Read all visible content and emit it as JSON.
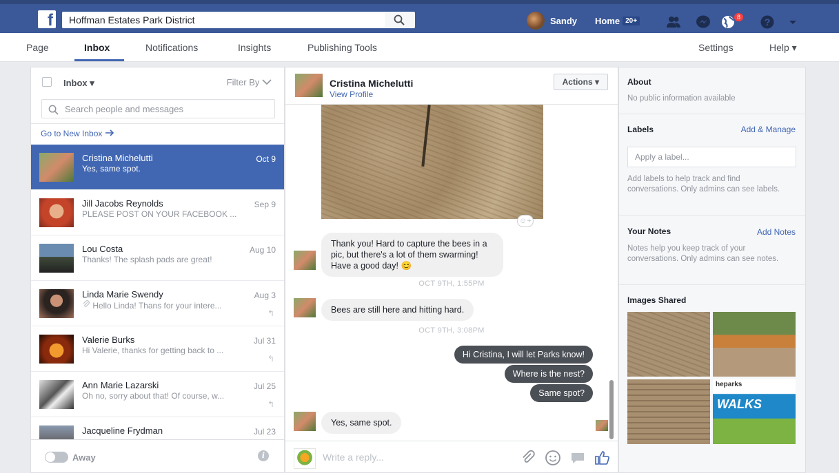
{
  "topbar": {
    "search_value": "Hoffman Estates Park District",
    "user_name": "Sandy",
    "home_label": "Home",
    "home_count": "20+",
    "notif_count": "8",
    "logo": "f",
    "colors": {
      "bar": "#3b5998",
      "accent": "#4267b2",
      "badge": "#fa3e3e"
    }
  },
  "pagenav": {
    "page": "Page",
    "inbox": "Inbox",
    "notifications": "Notifications",
    "insights": "Insights",
    "publishing_tools": "Publishing Tools",
    "settings": "Settings",
    "help": "Help ▾"
  },
  "left": {
    "inbox_label": "Inbox ▾",
    "filter_label": "Filter By",
    "search_placeholder": "Search people and messages",
    "go_new_inbox": "Go to New Inbox",
    "threads": [
      {
        "name": "Cristina Michelutti",
        "date": "Oct 9",
        "snippet": "Yes, same spot."
      },
      {
        "name": "Jill Jacobs Reynolds",
        "date": "Sep 9",
        "snippet": "PLEASE POST ON YOUR FACEBOOK ..."
      },
      {
        "name": "Lou Costa",
        "date": "Aug 10",
        "snippet": "Thanks! The splash pads are great!"
      },
      {
        "name": "Linda Marie Swendy",
        "date": "Aug 3",
        "snippet": "Hello Linda! Thans for your intere..."
      },
      {
        "name": "Valerie Burks",
        "date": "Jul 31",
        "snippet": "Hi Valerie, thanks for getting back to ..."
      },
      {
        "name": "Ann Marie Lazarski",
        "date": "Jul 25",
        "snippet": "Oh no, sorry about that! Of course, w..."
      },
      {
        "name": "Jacqueline Frydman",
        "date": "Jul 23",
        "snippet": ""
      }
    ],
    "away_label": "Away"
  },
  "conversation": {
    "name": "Cristina Michelutti",
    "view_profile": "View Profile",
    "actions_label": "Actions ▾",
    "msg_thank_you": "Thank you! Hard to capture the bees in a pic, but there's a lot of them swarming! Have a good day! 😊",
    "ts1": "OCT 9TH, 1:55PM",
    "msg_bees": "Bees are still here and hitting hard.",
    "ts2": "OCT 9TH, 3:08PM",
    "out1": "Hi Cristina, I will let Parks know!",
    "out2": "Where is the nest?",
    "out3": "Same spot?",
    "msg_same": "Yes, same spot.",
    "reply_placeholder": "Write a reply..."
  },
  "about": {
    "about_title": "About",
    "about_text": "No public information available",
    "labels_title": "Labels",
    "labels_link": "Add & Manage",
    "label_placeholder": "Apply a label...",
    "labels_help": "Add labels to help track and find conversations. Only admins can see labels.",
    "notes_title": "Your Notes",
    "notes_link": "Add Notes",
    "notes_help": "Notes help you keep track of your conversations. Only admins can see notes.",
    "images_title": "Images Shared",
    "poster_brand": "heparks",
    "poster_title": "WALKS"
  }
}
